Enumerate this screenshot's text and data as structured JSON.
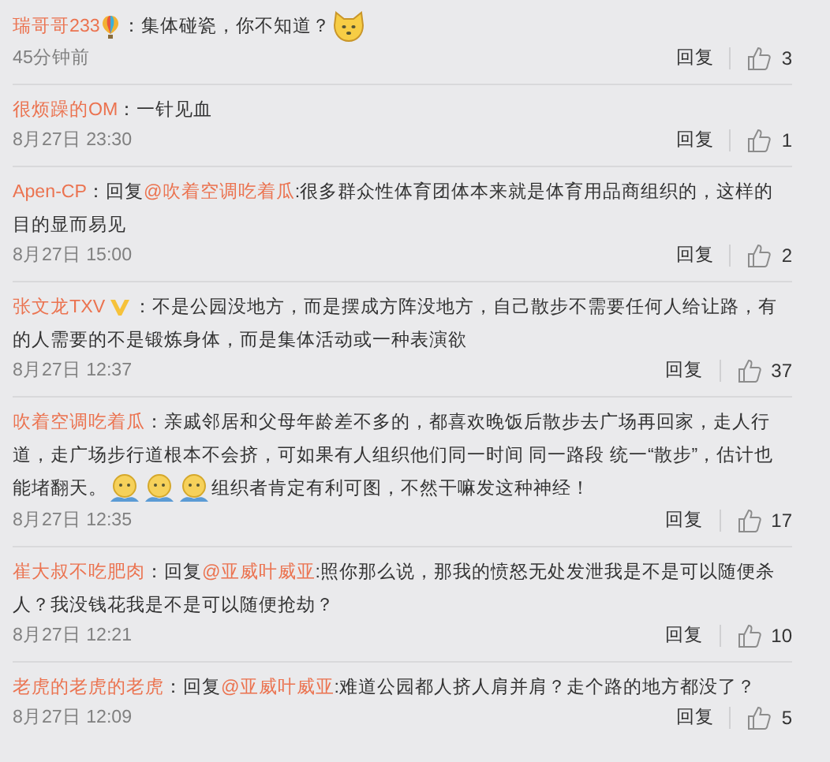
{
  "comments": [
    {
      "user": "瑞哥哥233",
      "badge": {
        "kind": "balloon"
      },
      "content": [
        {
          "kind": "text",
          "text": "：集体碰瓷，你不知道？"
        },
        {
          "kind": "emoji"
        }
      ],
      "time": "45分钟前",
      "reply": "回复",
      "likes": "3"
    },
    {
      "user": "很烦躁的OM",
      "content": [
        {
          "kind": "text",
          "text": "：一针见血"
        }
      ],
      "time": "8月27日 23:30",
      "reply": "回复",
      "likes": "1"
    },
    {
      "user": "Apen-CP",
      "content": [
        {
          "kind": "text",
          "text": "：回复"
        },
        {
          "kind": "mention",
          "text": "@吹着空调吃着瓜"
        },
        {
          "kind": "text",
          "text": ":很多群众性体育团体本来就是体育用品商组织的，这样的目的显而易见"
        }
      ],
      "time": "8月27日 15:00",
      "reply": "回复",
      "likes": "2"
    },
    {
      "user": "张文龙TXV",
      "badge": {
        "kind": "verified"
      },
      "content": [
        {
          "kind": "text",
          "text": "：不是公园没地方，而是摆成方阵没地方，自己散步不需要任何人给让路，有的人需要的不是锻炼身体，而是集体活动或一种表演欲"
        }
      ],
      "time": "8月27日 12:37",
      "reply": "回复",
      "likes": "37"
    },
    {
      "user": "吹着空调吃着瓜",
      "content": [
        {
          "kind": "text",
          "text": "：亲戚邻居和父母年龄差不多的，都喜欢晚饭后散步去广场再回家，走人行道，走广场步行道根本不会挤，可如果有人组织他们同一时间 同一路段 统一“散步”，估计也能堵翻天。"
        },
        {
          "kind": "emoji2"
        },
        {
          "kind": "emoji2"
        },
        {
          "kind": "emoji2"
        },
        {
          "kind": "text",
          "text": "组织者肯定有利可图，不然干嘛发这种神经！"
        }
      ],
      "time": "8月27日 12:35",
      "reply": "回复",
      "likes": "17"
    },
    {
      "user": "崔大叔不吃肥肉",
      "content": [
        {
          "kind": "text",
          "text": "：回复"
        },
        {
          "kind": "mention",
          "text": "@亚威叶威亚"
        },
        {
          "kind": "text",
          "text": ":照你那么说，那我的愤怒无处发泄我是不是可以随便杀人？我没钱花我是不是可以随便抢劫？"
        }
      ],
      "time": "8月27日 12:21",
      "reply": "回复",
      "likes": "10"
    },
    {
      "user": "老虎的老虎的老虎",
      "content": [
        {
          "kind": "text",
          "text": "：回复"
        },
        {
          "kind": "mention",
          "text": "@亚威叶威亚"
        },
        {
          "kind": "text",
          "text": ":难道公园都人挤人肩并肩？走个路的地方都没了？"
        }
      ],
      "time": "8月27日 12:09",
      "reply": "回复",
      "likes": "5"
    }
  ]
}
